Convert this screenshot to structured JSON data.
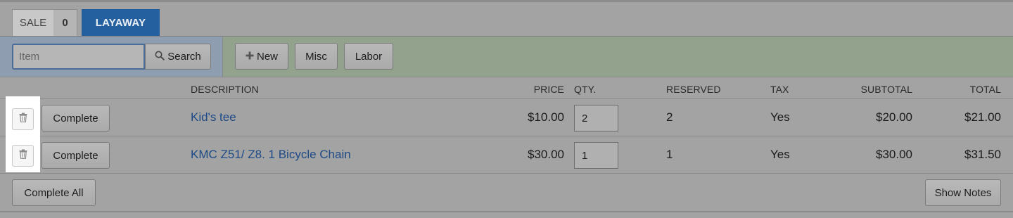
{
  "tabs": {
    "sale_label": "SALE",
    "sale_count": "0",
    "layaway_label": "LAYAWAY"
  },
  "toolbar": {
    "item_placeholder": "Item",
    "search_label": "Search",
    "new_label": "New",
    "misc_label": "Misc",
    "labor_label": "Labor"
  },
  "table": {
    "headers": {
      "description": "DESCRIPTION",
      "price": "PRICE",
      "qty": "QTY.",
      "reserved": "RESERVED",
      "tax": "TAX",
      "subtotal": "SUBTOTAL",
      "total": "TOTAL"
    },
    "complete_label": "Complete",
    "rows": [
      {
        "description": "Kid's tee",
        "price": "$10.00",
        "qty": "2",
        "reserved": "2",
        "tax": "Yes",
        "subtotal": "$20.00",
        "total": "$21.00"
      },
      {
        "description": "KMC Z51/ Z8. 1 Bicycle Chain",
        "price": "$30.00",
        "qty": "1",
        "reserved": "1",
        "tax": "Yes",
        "subtotal": "$30.00",
        "total": "$31.50"
      }
    ]
  },
  "footer": {
    "complete_all_label": "Complete All",
    "show_notes_label": "Show Notes"
  },
  "colors": {
    "layaway_tab": "#24609f",
    "description_link": "#1e4a86",
    "search_bar_bg": "#8e9db0",
    "actions_bar_bg": "#93a28c"
  },
  "icons": {
    "search": "search-icon",
    "new": "plus-icon",
    "delete": "trash-icon"
  }
}
